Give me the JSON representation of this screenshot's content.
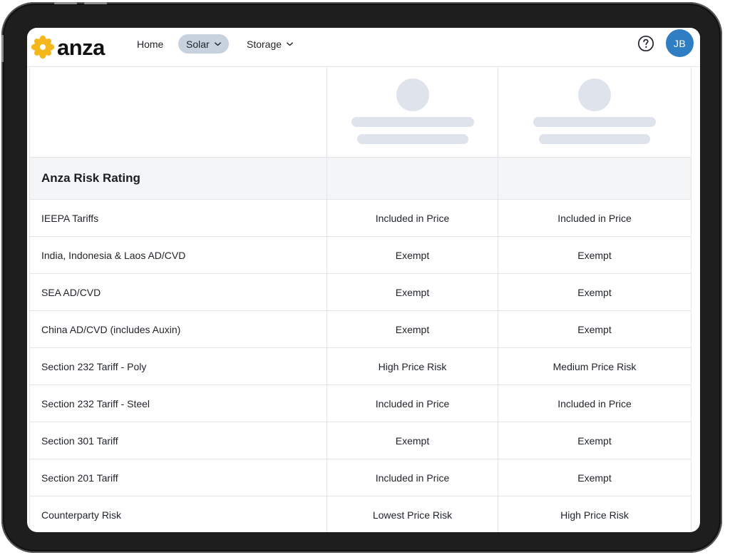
{
  "nav": {
    "logo_text": "anza",
    "logo_icon": "flower-logo-icon",
    "items": [
      {
        "label": "Home"
      },
      {
        "label": "Solar",
        "active": true,
        "icon": "chevron-down-icon"
      },
      {
        "label": "Storage",
        "icon": "chevron-down-icon"
      }
    ],
    "help_icon": "help-circle-icon",
    "avatar_initials": "JB"
  },
  "colors": {
    "brand_yellow": "#f5b81c",
    "active_pill": "#c7d2de",
    "avatar": "#2f7ec4",
    "placeholder": "#dfe4ec",
    "section_bg": "#f4f5f7"
  },
  "table": {
    "section_title": "Anza Risk Rating",
    "rows": [
      {
        "label": "IEEPA Tariffs",
        "a": "Included in Price",
        "b": "Included in Price"
      },
      {
        "label": "India, Indonesia & Laos AD/CVD",
        "a": "Exempt",
        "b": "Exempt"
      },
      {
        "label": "SEA AD/CVD",
        "a": "Exempt",
        "b": "Exempt"
      },
      {
        "label": "China AD/CVD (includes Auxin)",
        "a": "Exempt",
        "b": "Exempt"
      },
      {
        "label": "Section 232 Tariff - Poly",
        "a": "High Price Risk",
        "b": "Medium Price Risk"
      },
      {
        "label": "Section 232 Tariff - Steel",
        "a": "Included in Price",
        "b": "Included in Price"
      },
      {
        "label": "Section 301 Tariff",
        "a": "Exempt",
        "b": "Exempt"
      },
      {
        "label": "Section 201 Tariff",
        "a": "Included in Price",
        "b": "Exempt"
      },
      {
        "label": "Counterparty Risk",
        "a": "Lowest Price Risk",
        "b": "High Price Risk"
      }
    ]
  }
}
